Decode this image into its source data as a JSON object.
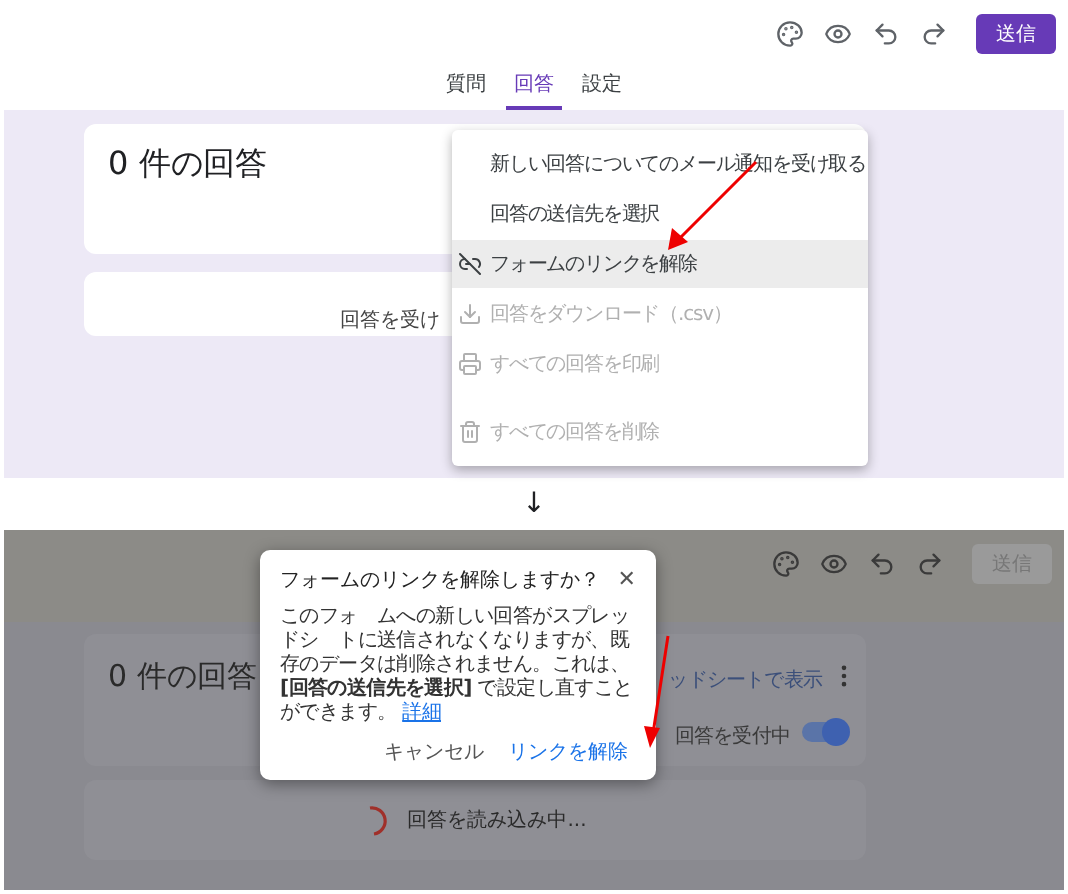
{
  "before": {
    "toolbar": {
      "send_button": {
        "label": "送信",
        "disabled": false
      }
    },
    "tabs": [
      {
        "label": "質問",
        "selected": false
      },
      {
        "label": "回答",
        "selected": true
      },
      {
        "label": "設定",
        "selected": false
      }
    ],
    "response_card": {
      "title": "0 件の回答"
    },
    "accepting_card": {
      "text": "回答を受け"
    },
    "menu": {
      "items": [
        {
          "kind": "none",
          "label": "新しい回答についてのメール通知を受け取る",
          "disabled": false,
          "selected": false
        },
        {
          "kind": "none",
          "label": "回答の送信先を選択",
          "disabled": false,
          "selected": false
        },
        {
          "kind": "unlink",
          "label": "フォームのリンクを解除",
          "disabled": false,
          "selected": true
        },
        {
          "kind": "download",
          "label": "回答をダウンロード（.csv）",
          "disabled": true,
          "selected": false
        },
        {
          "kind": "print",
          "label": "すべての回答を印刷",
          "disabled": true,
          "selected": false
        },
        {
          "kind": "trash",
          "label": "すべての回答を削除",
          "disabled": true,
          "selected": false
        }
      ]
    }
  },
  "transition_arrow": "↓",
  "after": {
    "toolbar": {
      "send_button": {
        "label": "送信",
        "disabled": true
      }
    },
    "response_card": {
      "title": "0 件の回答",
      "sheet_link": "ッドシートで表示",
      "toggle_label": "回答を受付中",
      "toggle_on": true
    },
    "loading_card": {
      "text": "回答を読み込み中..."
    },
    "dialog": {
      "title": "フォームのリンクを解除しますか？",
      "close": "✕",
      "body": "このフォ　ムへの新しい回答がスプレッドシ　トに送信されなくなりますが、既存のデータは削除されません。これは、**[回答の送信先を選択]** で設定し直すことができます。",
      "link": "詳細",
      "buttons": [
        "キャンセル",
        "リンクを解除"
      ]
    }
  }
}
